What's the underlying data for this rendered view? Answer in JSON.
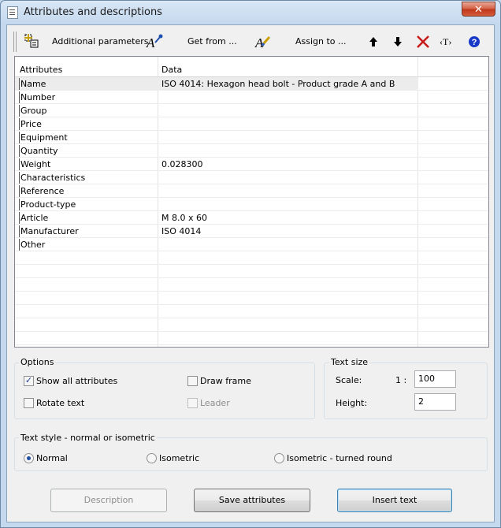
{
  "window": {
    "title": "Attributes and descriptions",
    "close_label": "✕"
  },
  "toolbar": {
    "additional_parameters": "Additional parameters",
    "get_from": "Get from ...",
    "assign_to": "Assign to ..."
  },
  "grid": {
    "col_attributes": "Attributes",
    "col_data": "Data",
    "rows": [
      {
        "attr": "Name",
        "data": "ISO 4014: Hexagon head bolt - Product grade A and B"
      },
      {
        "attr": "Number",
        "data": ""
      },
      {
        "attr": "Group",
        "data": ""
      },
      {
        "attr": "Price",
        "data": ""
      },
      {
        "attr": "Equipment",
        "data": ""
      },
      {
        "attr": "Quantity",
        "data": ""
      },
      {
        "attr": "Weight",
        "data": "0.028300"
      },
      {
        "attr": "Characteristics",
        "data": ""
      },
      {
        "attr": "Reference",
        "data": ""
      },
      {
        "attr": "Product-type",
        "data": ""
      },
      {
        "attr": "Article",
        "data": "M 8.0 x 60"
      },
      {
        "attr": "Manufacturer",
        "data": "ISO 4014"
      },
      {
        "attr": "Other",
        "data": ""
      }
    ]
  },
  "options": {
    "title": "Options",
    "show_all": "Show all attributes",
    "rotate_text": "Rotate text",
    "draw_frame": "Draw frame",
    "leader": "Leader"
  },
  "text_size": {
    "title": "Text size",
    "scale_label": "Scale:",
    "scale_prefix": "1 :",
    "scale_value": "100",
    "height_label": "Height:",
    "height_value": "2"
  },
  "text_style": {
    "title": "Text style - normal or isometric",
    "normal": "Normal",
    "isometric": "Isometric",
    "isometric_turned": "Isometric - turned round"
  },
  "buttons": {
    "description": "Description",
    "save_attributes": "Save attributes",
    "insert_text": "Insert text"
  }
}
